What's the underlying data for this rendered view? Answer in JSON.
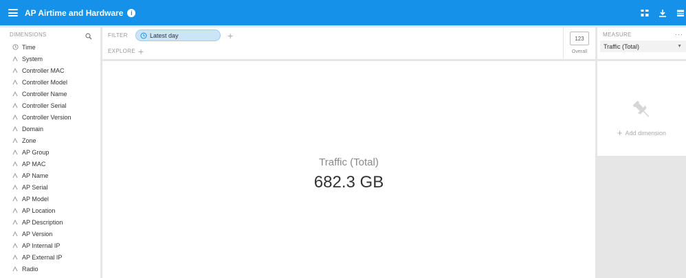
{
  "header": {
    "title": "AP Airtime and Hardware",
    "info_glyph": "i"
  },
  "dimensions": {
    "label": "DIMENSIONS",
    "items": [
      {
        "label": "Time",
        "icon": "clock-icon"
      },
      {
        "label": "System",
        "icon": "string-icon"
      },
      {
        "label": "Controller MAC",
        "icon": "string-icon"
      },
      {
        "label": "Controller Model",
        "icon": "string-icon"
      },
      {
        "label": "Controller Name",
        "icon": "string-icon"
      },
      {
        "label": "Controller Serial",
        "icon": "string-icon"
      },
      {
        "label": "Controller Version",
        "icon": "string-icon"
      },
      {
        "label": "Domain",
        "icon": "string-icon"
      },
      {
        "label": "Zone",
        "icon": "string-icon"
      },
      {
        "label": "AP Group",
        "icon": "string-icon"
      },
      {
        "label": "AP MAC",
        "icon": "string-icon"
      },
      {
        "label": "AP Name",
        "icon": "string-icon"
      },
      {
        "label": "AP Serial",
        "icon": "string-icon"
      },
      {
        "label": "AP Model",
        "icon": "string-icon"
      },
      {
        "label": "AP Location",
        "icon": "string-icon"
      },
      {
        "label": "AP Description",
        "icon": "string-icon"
      },
      {
        "label": "AP Version",
        "icon": "string-icon"
      },
      {
        "label": "AP Internal IP",
        "icon": "string-icon"
      },
      {
        "label": "AP External IP",
        "icon": "string-icon"
      },
      {
        "label": "Radio",
        "icon": "string-icon"
      }
    ]
  },
  "filter": {
    "label": "FILTER",
    "pill": "Latest day"
  },
  "explore": {
    "label": "EXPLORE"
  },
  "overall": {
    "box": "123",
    "label": "Overall"
  },
  "visualization": {
    "measure_title": "Traffic (Total)",
    "value": "682.3 GB"
  },
  "measure": {
    "label": "MEASURE",
    "more": "···",
    "selected": "Traffic (Total)"
  },
  "pinboard": {
    "add_label": "Add dimension"
  },
  "colors": {
    "topbar": "#1591ea",
    "pill_bg": "#cbe5f8",
    "background": "#e6e6e6"
  }
}
